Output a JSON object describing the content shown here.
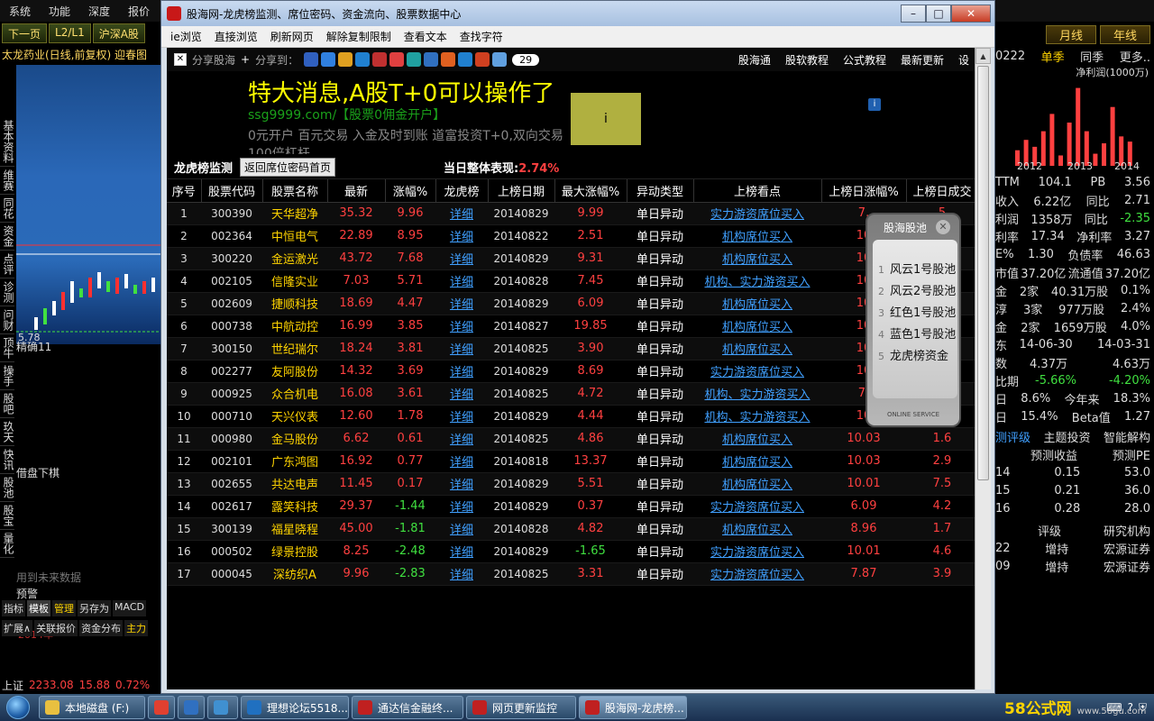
{
  "app": {
    "menu": [
      "系统",
      "功能",
      "深度",
      "报价"
    ],
    "toolbar": [
      "下一页",
      "L2/L1",
      "沪深A股"
    ],
    "chart_title": "太龙药业(日线,前复权) 迎春图",
    "left_nav": [
      "基本资料",
      "维赛",
      "同花",
      "资金",
      "点评",
      "诊测",
      "问财",
      "顶牛",
      "操手",
      "股吧",
      "玖天",
      "快讯",
      "股池",
      "股宝",
      "量化"
    ],
    "chart_price": "5.78",
    "indicator_1": "精确11",
    "indicator_2": "借盘下棋",
    "future_note": "用到未来数据",
    "warning": "预警",
    "year_label": "2014年",
    "year_sep": "2",
    "left_tabs": [
      "指标",
      "模板",
      "管理",
      "另存为",
      "MACD"
    ],
    "left_tabs2": [
      "扩展∧",
      "关联报价",
      "资金分布",
      "主力"
    ],
    "status": {
      "name": "上证",
      "index": "2233.08",
      "change": "15.88",
      "pct": "0.72%"
    }
  },
  "right": {
    "top_links": [
      "交易",
      "网站"
    ],
    "tabs": [
      "月线",
      "年线"
    ],
    "header_left": "0222",
    "header_items": [
      "单季",
      "同季",
      "更多.."
    ],
    "profit_label": "净利润(1000万)",
    "years": [
      "2012",
      "2013",
      "2014"
    ],
    "bars": [
      {
        "h": 0.18,
        "c": "#ff4040"
      },
      {
        "h": 0.3,
        "c": "#ff4040"
      },
      {
        "h": 0.22,
        "c": "#ff4040"
      },
      {
        "h": 0.4,
        "c": "#ff4040"
      },
      {
        "h": 0.6,
        "c": "#ff4040"
      },
      {
        "h": 0.12,
        "c": "#ff4040"
      },
      {
        "h": 0.5,
        "c": "#ff4040"
      },
      {
        "h": 0.9,
        "c": "#ff4040"
      },
      {
        "h": 0.4,
        "c": "#ff4040"
      },
      {
        "h": 0.14,
        "c": "#ff4040"
      },
      {
        "h": 0.26,
        "c": "#ff4040"
      },
      {
        "h": 0.68,
        "c": "#ff4040"
      },
      {
        "h": 0.34,
        "c": "#ff4040"
      },
      {
        "h": 0.28,
        "c": "#ff4040"
      }
    ],
    "rows": [
      [
        "TTM",
        "104.1",
        "PB",
        "3.56"
      ],
      [
        "收入",
        "6.22亿",
        "同比",
        "2.71"
      ],
      [
        "利润",
        "1358万",
        "同比",
        "-2.35"
      ],
      [
        "利率",
        "17.34",
        "净利率",
        "3.27"
      ],
      [
        "E%",
        "1.30",
        "负债率",
        "46.63"
      ],
      [
        "市值",
        "37.20亿",
        "流通值",
        "37.20亿"
      ],
      [
        "金",
        "2家",
        "40.31万股",
        "0.1%"
      ],
      [
        "淳",
        "3家",
        "977万股",
        "2.4%"
      ],
      [
        "金",
        "2家",
        "1659万股",
        "4.0%"
      ],
      [
        "东",
        "14-06-30",
        "",
        "14-03-31"
      ],
      [
        "数",
        "4.37万",
        "",
        "4.63万"
      ],
      [
        "比期",
        "-5.66%",
        "",
        "-4.20%"
      ],
      [
        "日",
        "8.6%",
        "今年来",
        "18.3%"
      ],
      [
        "日",
        "15.4%",
        "Beta值",
        "1.27"
      ]
    ],
    "tabs2": [
      "测评级",
      "主题投资",
      "智能解构"
    ],
    "forecast_header": [
      "预测收益",
      "预测PE"
    ],
    "forecast": [
      [
        "14",
        "0.15",
        "53.0"
      ],
      [
        "15",
        "0.21",
        "36.0"
      ],
      [
        "16",
        "0.28",
        "28.0"
      ]
    ],
    "rating_header": [
      "评级",
      "研究机构"
    ],
    "ratings": [
      [
        "22",
        "增持",
        "宏源证券"
      ],
      [
        "09",
        "增持",
        "宏源证券"
      ]
    ]
  },
  "window": {
    "title": "股海网-龙虎榜监测、席位密码、资金流向、股票数据中心",
    "menu": [
      "ie浏览",
      "直接浏览",
      "刷新网页",
      "解除复制限制",
      "查看文本",
      "查找字符"
    ]
  },
  "page": {
    "share_label": "分享股海",
    "share_to": "分享到：",
    "share_count": "29",
    "share_icon_colors": [
      "#3060c0",
      "#3080e0",
      "#e0a020",
      "#2080d0",
      "#c03030",
      "#e04040",
      "#20a0a0",
      "#3070c0",
      "#e06020",
      "#2080d0",
      "#d04020",
      "#60a0e0"
    ],
    "top_links": [
      "股海通",
      "股软教程",
      "公式教程",
      "最新更新",
      "设"
    ],
    "ad": {
      "title": "特大消息,A股T+0可以操作了",
      "link": "ssg9999.com/【股票0佣金开户】",
      "desc": "0元开户 百元交易 入金及时到账 道富投资T+0,双向交易 100倍杠杆",
      "box": "i"
    },
    "lhb_title": "龙虎榜监测",
    "back_button": "返回席位密码首页",
    "perf_label": "当日整体表现:",
    "perf_value": "2.74%",
    "columns": [
      "序号",
      "股票代码",
      "股票名称",
      "最新",
      "涨幅%",
      "龙虎榜",
      "上榜日期",
      "最大涨幅%",
      "异动类型",
      "上榜看点",
      "上榜日涨幅%",
      "上榜日成交"
    ],
    "rows": [
      [
        "1",
        "300390",
        "天华超净",
        "35.32",
        "9.96",
        "详细",
        "20140829",
        "9.99",
        "单日异动",
        "实力游资席位买入",
        "7.",
        "5"
      ],
      [
        "2",
        "002364",
        "中恒电气",
        "22.89",
        "8.95",
        "详细",
        "20140822",
        "2.51",
        "单日异动",
        "机构席位买入",
        "10",
        "0"
      ],
      [
        "3",
        "300220",
        "金运激光",
        "43.72",
        "7.68",
        "详细",
        "20140829",
        "9.31",
        "单日异动",
        "机构席位买入",
        "10",
        "0"
      ],
      [
        "4",
        "002105",
        "信隆实业",
        "7.03",
        "5.71",
        "详细",
        "20140828",
        "7.45",
        "单日异动",
        "机构、实力游资买入",
        "10",
        "4"
      ],
      [
        "5",
        "002609",
        "捷顺科技",
        "18.69",
        "4.47",
        "详细",
        "20140829",
        "6.09",
        "单日异动",
        "机构席位买入",
        "10",
        "7"
      ],
      [
        "6",
        "000738",
        "中航动控",
        "16.99",
        "3.85",
        "详细",
        "20140827",
        "19.85",
        "单日异动",
        "机构席位买入",
        "10",
        "0"
      ],
      [
        "7",
        "300150",
        "世纪瑞尔",
        "18.24",
        "3.81",
        "详细",
        "20140825",
        "3.90",
        "单日异动",
        "机构席位买入",
        "10",
        "3"
      ],
      [
        "8",
        "002277",
        "友阿股份",
        "14.32",
        "3.69",
        "详细",
        "20140829",
        "8.69",
        "单日异动",
        "实力游资席位买入",
        "10",
        "9"
      ],
      [
        "9",
        "000925",
        "众合机电",
        "16.08",
        "3.61",
        "详细",
        "20140825",
        "4.72",
        "单日异动",
        "机构、实力游资买入",
        "7.",
        "4"
      ],
      [
        "10",
        "000710",
        "天兴仪表",
        "12.60",
        "1.78",
        "详细",
        "20140829",
        "4.44",
        "单日异动",
        "机构、实力游资买入",
        "10",
        "8"
      ],
      [
        "11",
        "000980",
        "金马股份",
        "6.62",
        "0.61",
        "详细",
        "20140825",
        "4.86",
        "单日异动",
        "机构席位买入",
        "10.03",
        "1.6"
      ],
      [
        "12",
        "002101",
        "广东鸿图",
        "16.92",
        "0.77",
        "详细",
        "20140818",
        "13.37",
        "单日异动",
        "机构席位买入",
        "10.03",
        "2.9"
      ],
      [
        "13",
        "002655",
        "共达电声",
        "11.45",
        "0.17",
        "详细",
        "20140829",
        "5.51",
        "单日异动",
        "机构席位买入",
        "10.01",
        "7.5"
      ],
      [
        "14",
        "002617",
        "露笑科技",
        "29.37",
        "-1.44",
        "详细",
        "20140829",
        "0.37",
        "单日异动",
        "实力游资席位买入",
        "6.09",
        "4.2"
      ],
      [
        "15",
        "300139",
        "福星晓程",
        "45.00",
        "-1.81",
        "详细",
        "20140828",
        "4.82",
        "单日异动",
        "机构席位买入",
        "8.96",
        "1.7"
      ],
      [
        "16",
        "000502",
        "绿景控股",
        "8.25",
        "-2.48",
        "详细",
        "20140829",
        "-1.65",
        "单日异动",
        "实力游资席位买入",
        "10.01",
        "4.6"
      ],
      [
        "17",
        "000045",
        "深纺织A",
        "9.96",
        "-2.83",
        "详细",
        "20140825",
        "3.31",
        "单日异动",
        "实力游资席位买入",
        "7.87",
        "3.9"
      ]
    ],
    "pool": {
      "title": "股海股池",
      "items": [
        "风云1号股池",
        "风云2号股池",
        "红色1号股池",
        "蓝色1号股池",
        "龙虎榜资金"
      ],
      "footer": "ONLINE SERVICE"
    }
  },
  "taskbar": {
    "tasks": [
      {
        "label": "本地磁盘 (F:)",
        "color": "#e8c040"
      },
      {
        "label": "",
        "color": "#e04030"
      },
      {
        "label": "",
        "color": "#3070c0"
      },
      {
        "label": "",
        "color": "#4090d0"
      },
      {
        "label": "理想论坛5518...",
        "color": "#2070c0"
      },
      {
        "label": "通达信金融终...",
        "color": "#c02020"
      },
      {
        "label": "网页更新监控",
        "color": "#c02020"
      },
      {
        "label": "股海网-龙虎榜...",
        "color": "#c02020"
      }
    ],
    "logo": "58公式网",
    "logo_url": "www.58gu.com"
  }
}
